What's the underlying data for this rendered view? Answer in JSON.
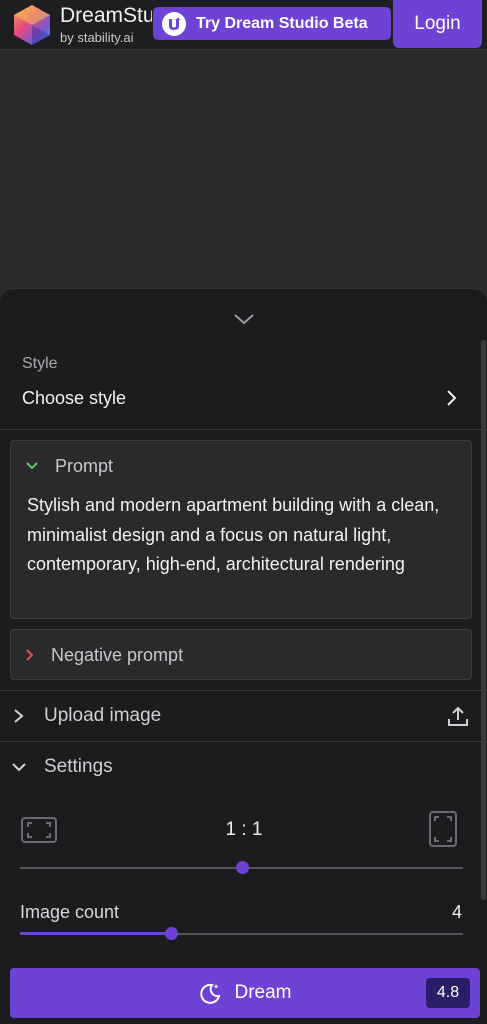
{
  "header": {
    "brand_title": "DreamStudio",
    "brand_sub": "by stability.ai",
    "beta_button": "Try Dream Studio Beta",
    "login_button": "Login"
  },
  "style": {
    "label": "Style",
    "value": "Choose style"
  },
  "prompt": {
    "label": "Prompt",
    "text": "Stylish and modern apartment building with a clean, minimalist design and a focus on natural light, contemporary, high-end, architectural rendering"
  },
  "negative_prompt": {
    "label": "Negative prompt"
  },
  "upload": {
    "label": "Upload image"
  },
  "settings": {
    "label": "Settings",
    "aspect_ratio": "1 : 1",
    "aspect_ratio_position": 0.5,
    "image_count_label": "Image count",
    "image_count": "4",
    "image_count_position": 0.34
  },
  "dream": {
    "label": "Dream",
    "cost": "4.8"
  },
  "colors": {
    "accent": "#6d43d6",
    "panel": "#1c1c1e",
    "card": "#2a2a2c"
  }
}
